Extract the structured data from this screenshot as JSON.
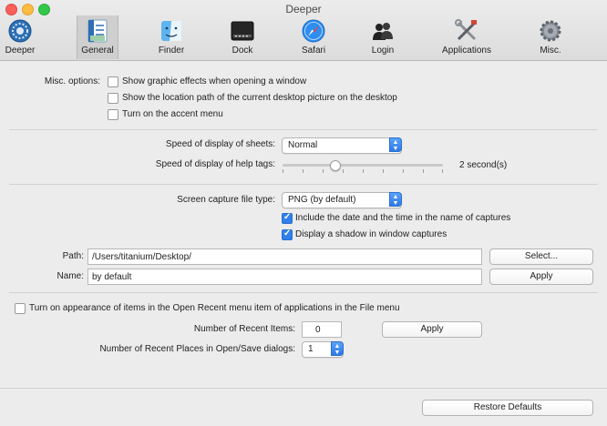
{
  "window": {
    "title": "Deeper"
  },
  "toolbar": {
    "tabs": [
      {
        "label": "Deeper",
        "icon": "deeper-icon"
      },
      {
        "label": "General",
        "icon": "general-icon",
        "selected": true
      },
      {
        "label": "Finder",
        "icon": "finder-icon"
      },
      {
        "label": "Dock",
        "icon": "dock-icon"
      },
      {
        "label": "Safari",
        "icon": "safari-icon"
      },
      {
        "label": "Login",
        "icon": "login-icon"
      },
      {
        "label": "Applications",
        "icon": "applications-icon"
      },
      {
        "label": "Misc.",
        "icon": "misc-icon"
      }
    ]
  },
  "misc": {
    "label": "Misc. options:",
    "options": [
      {
        "label": "Show graphic effects when opening a window",
        "checked": false
      },
      {
        "label": "Show the location path of the current desktop picture on the desktop",
        "checked": false
      },
      {
        "label": "Turn on the accent menu",
        "checked": false
      }
    ]
  },
  "sheets": {
    "label": "Speed of display of sheets:",
    "value": "Normal"
  },
  "help_tags": {
    "label": "Speed of display of help tags:",
    "value_text": "2 second(s)",
    "slider_fraction": 0.33
  },
  "capture": {
    "label": "Screen capture file type:",
    "value": "PNG (by default)",
    "options": [
      {
        "label": "Include the date and the time in the name of captures",
        "checked": true
      },
      {
        "label": "Display a shadow in window captures",
        "checked": true
      }
    ]
  },
  "path": {
    "label": "Path:",
    "value": "/Users/titanium/Desktop/",
    "button": "Select..."
  },
  "name": {
    "label": "Name:",
    "value": "by default",
    "button": "Apply"
  },
  "recent": {
    "checkbox_label": "Turn on appearance of items in the Open Recent menu item of applications in the File menu",
    "checked": false,
    "items_label": "Number of Recent Items:",
    "items_value": "0",
    "items_button": "Apply",
    "places_label": "Number of Recent Places in Open/Save dialogs:",
    "places_value": "1"
  },
  "footer": {
    "restore_button": "Restore Defaults"
  },
  "colors": {
    "accent": "#2f80ed",
    "close": "#fc605b",
    "minimize": "#fdbc40",
    "maximize": "#34c84a"
  }
}
